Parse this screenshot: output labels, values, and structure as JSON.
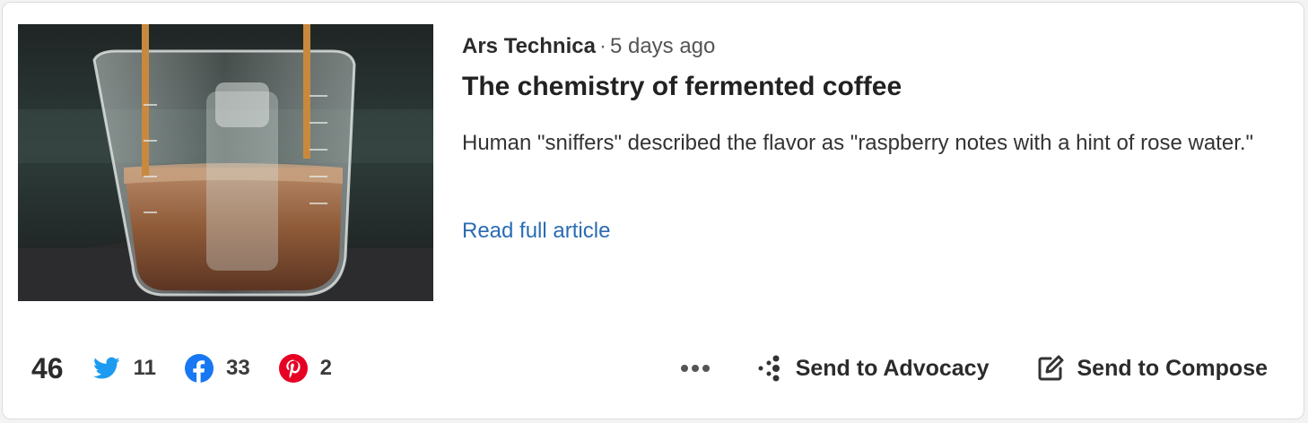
{
  "article": {
    "source": "Ars Technica",
    "separator": "·",
    "time_ago": "5 days ago",
    "title": "The chemistry of fermented coffee",
    "description": "Human \"sniffers\" described the flavor as \"raspberry notes with a hint of rose water.\"",
    "read_more_label": "Read full article",
    "image_icon": "coffee-beaker-photo"
  },
  "shares": {
    "total": "46",
    "twitter": {
      "count": "11",
      "icon": "twitter-icon",
      "color": "#1d9bf0"
    },
    "facebook": {
      "count": "33",
      "icon": "facebook-icon",
      "color": "#1877f2"
    },
    "pinterest": {
      "count": "2",
      "icon": "pinterest-icon",
      "color": "#e60023"
    }
  },
  "actions": {
    "more_icon": "more-icon",
    "advocacy_label": "Send to Advocacy",
    "compose_label": "Send to Compose"
  },
  "colors": {
    "link": "#2a6cb3",
    "text": "#2b2b2b"
  }
}
